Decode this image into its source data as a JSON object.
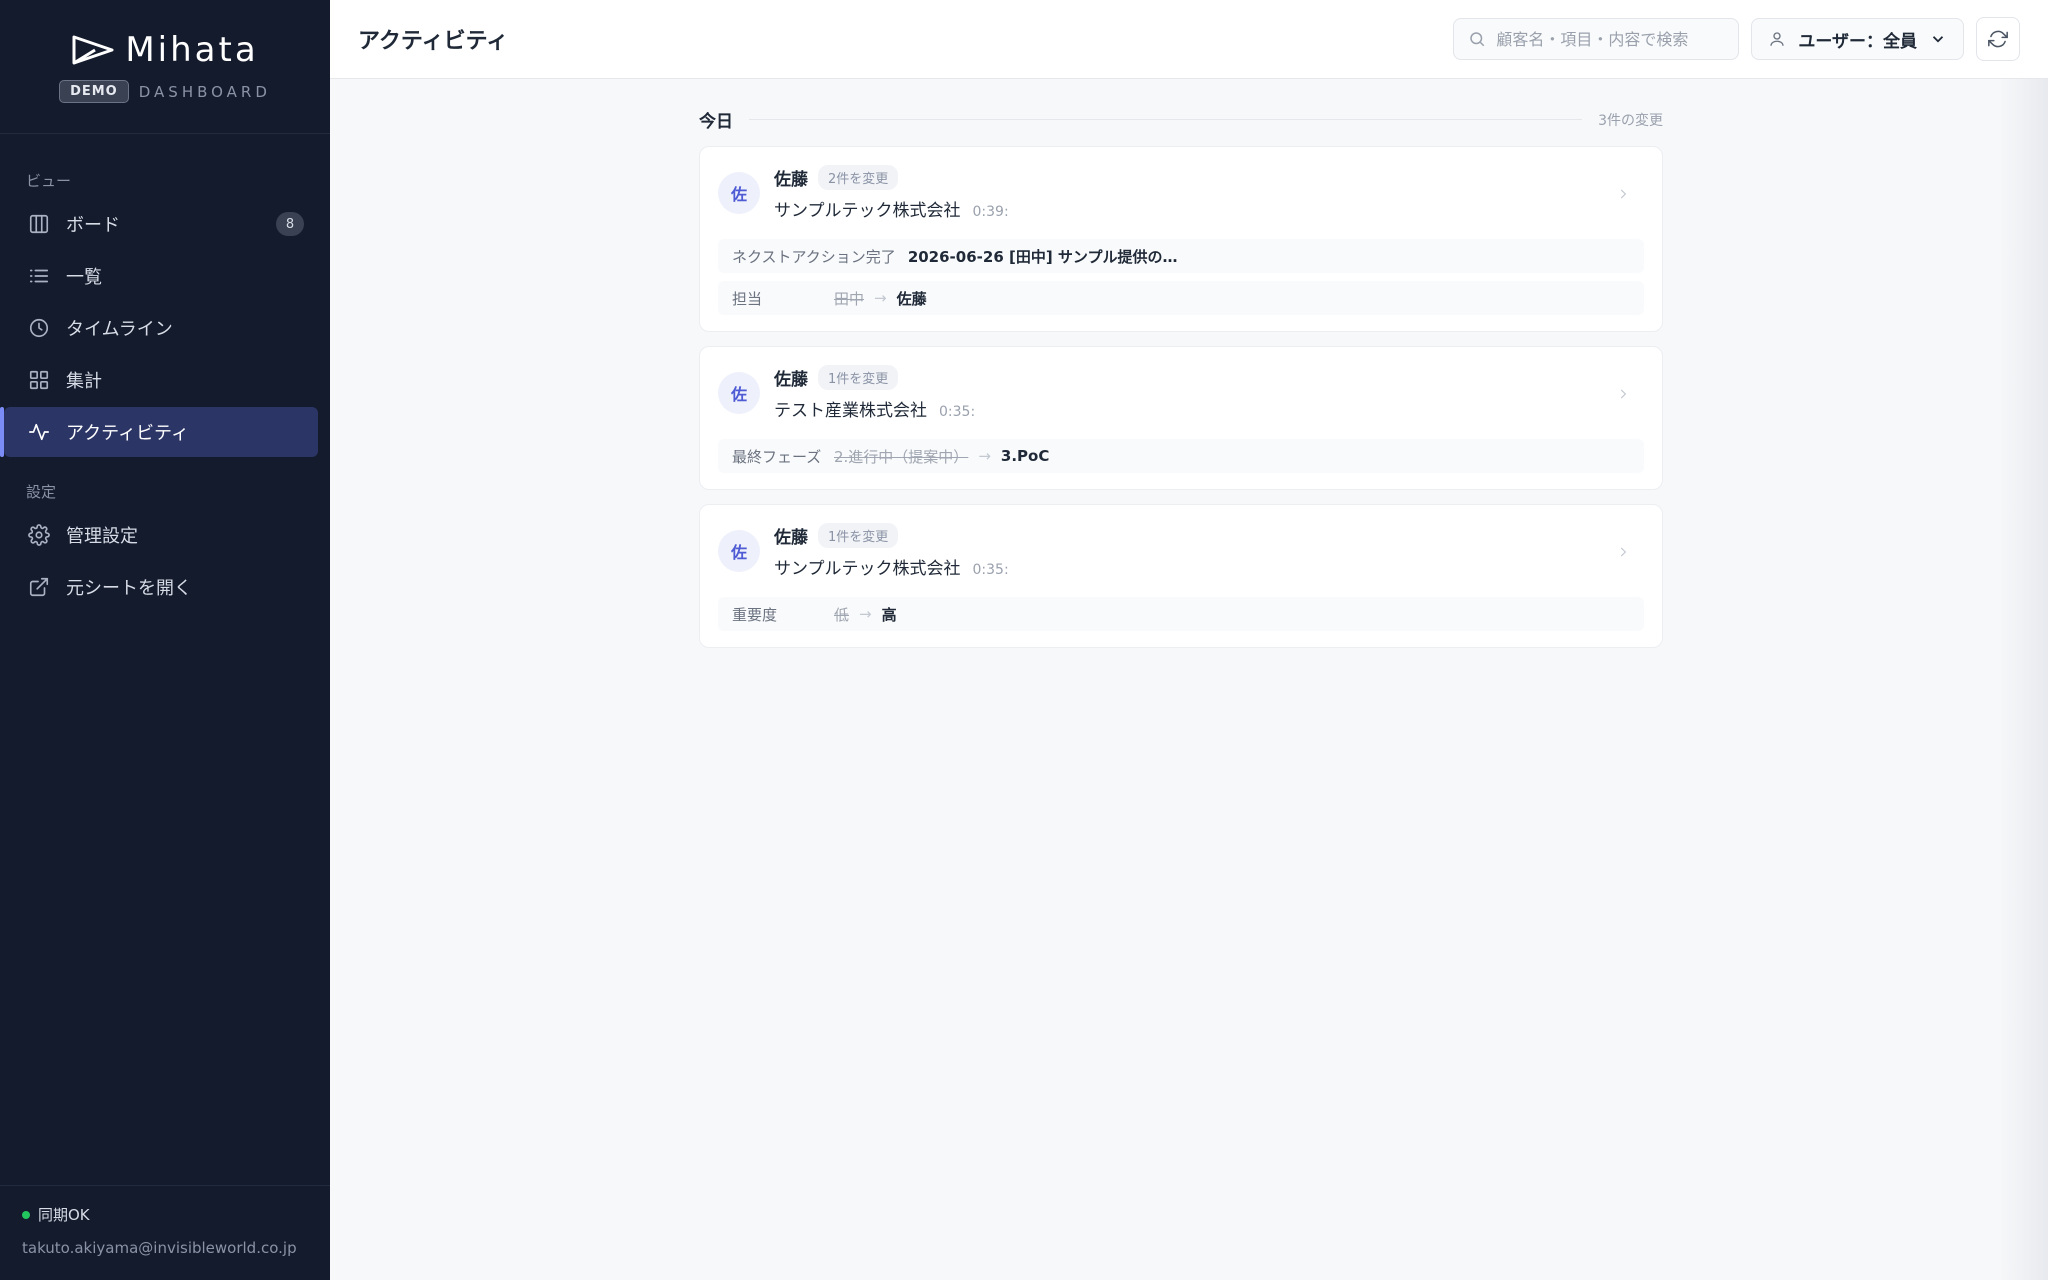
{
  "brand": {
    "name": "Mihata",
    "badge": "DEMO",
    "subtitle": "DASHBOARD"
  },
  "sidebar": {
    "sections": [
      {
        "label": "ビュー"
      },
      {
        "label": "設定"
      }
    ],
    "items": [
      {
        "label": "ボード",
        "icon": "board-icon",
        "count": "8"
      },
      {
        "label": "一覧",
        "icon": "list-icon"
      },
      {
        "label": "タイムライン",
        "icon": "clock-icon"
      },
      {
        "label": "集計",
        "icon": "grid-icon"
      },
      {
        "label": "アクティビティ",
        "icon": "activity-icon",
        "active": true
      },
      {
        "label": "管理設定",
        "icon": "gear-icon"
      },
      {
        "label": "元シートを開く",
        "icon": "external-link-icon"
      }
    ],
    "footer": {
      "sync_status": "同期OK",
      "email": "takuto.akiyama@invisibleworld.co.jp"
    }
  },
  "header": {
    "title": "アクティビティ",
    "search": {
      "placeholder": "顧客名・項目・内容で検索",
      "value": ""
    },
    "user_filter": "ユーザー：全員"
  },
  "feed": {
    "day_label": "今日",
    "day_count": "3件の変更",
    "cards": [
      {
        "avatar": "佐",
        "user": "佐藤",
        "badge": "2件を変更",
        "company": "サンプルテック株式会社",
        "time": "0:39:",
        "changes": [
          {
            "field": "ネクストアクション完了",
            "value": "2026-06-26 [田中] サンプル提供の…"
          },
          {
            "field": "担当",
            "old": "田中",
            "arrow": "→",
            "new": "佐藤"
          }
        ]
      },
      {
        "avatar": "佐",
        "user": "佐藤",
        "badge": "1件を変更",
        "company": "テスト産業株式会社",
        "time": "0:35:",
        "changes": [
          {
            "field": "最終フェーズ",
            "old": "2.進行中（提案中）",
            "arrow": "→",
            "new": "3.PoC"
          }
        ]
      },
      {
        "avatar": "佐",
        "user": "佐藤",
        "badge": "1件を変更",
        "company": "サンプルテック株式会社",
        "time": "0:35:",
        "changes": [
          {
            "field": "重要度",
            "old": "低",
            "arrow": "→",
            "new": "高"
          }
        ]
      }
    ]
  },
  "colors": {
    "sidebar_bg": "#141b2d",
    "active_bg": "#2b3566",
    "accent": "#7b8cf6",
    "sync_ok": "#22c55e"
  }
}
